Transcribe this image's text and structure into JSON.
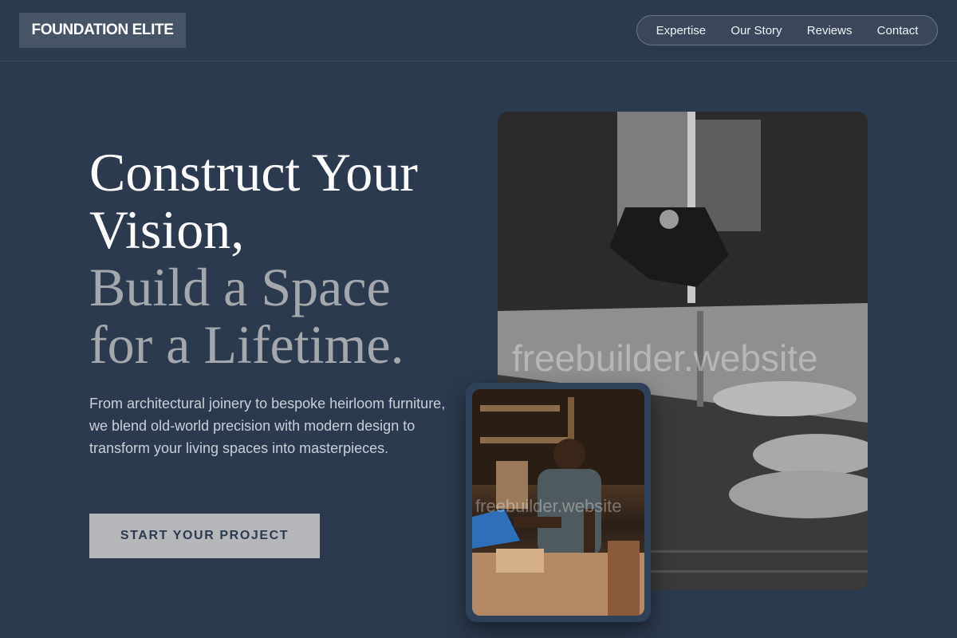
{
  "brand": {
    "logo_text": "FOUNDATION ELITE"
  },
  "nav": {
    "items": [
      {
        "label": "Expertise"
      },
      {
        "label": "Our Story"
      },
      {
        "label": "Reviews"
      },
      {
        "label": "Contact"
      }
    ]
  },
  "hero": {
    "headline_line1": "Construct Your Vision,",
    "headline_line2": "Build a Space for a Lifetime.",
    "description": "From architectural joinery to bespoke heirloom furniture, we blend old-world precision with modern design to transform your living spaces into masterpieces.",
    "cta_label": "START YOUR PROJECT"
  },
  "images": {
    "main_icon": "bandsaw-photo",
    "main_watermark": "freebuilder.website",
    "secondary_icon": "craftsman-photo",
    "secondary_watermark": "freebuilder.website"
  },
  "colors": {
    "background": "#2c3a4f",
    "accent_button": "#b5b7ba",
    "headline_muted": "#a4a8ad"
  }
}
